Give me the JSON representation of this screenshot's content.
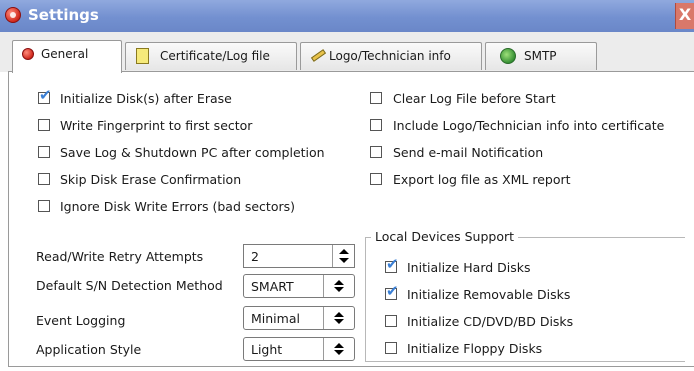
{
  "window": {
    "title": "Settings",
    "close_glyph": "X"
  },
  "tabs": [
    {
      "label": "General",
      "icon": "shield-logo-icon"
    },
    {
      "label": "Certificate/Log file",
      "icon": "document-icon"
    },
    {
      "label": "Logo/Technician info",
      "icon": "pen-icon"
    },
    {
      "label": "SMTP",
      "icon": "email-icon"
    }
  ],
  "options_left": [
    {
      "label": "Initialize Disk(s) after Erase",
      "checked": true
    },
    {
      "label": "Write Fingerprint to first sector",
      "checked": false
    },
    {
      "label": "Save Log & Shutdown PC after completion",
      "checked": false
    },
    {
      "label": "Skip Disk Erase Confirmation",
      "checked": false
    },
    {
      "label": "Ignore Disk Write Errors (bad sectors)",
      "checked": false
    }
  ],
  "options_right": [
    {
      "label": "Clear Log File before Start",
      "checked": false
    },
    {
      "label": "Include Logo/Technician info into certificate",
      "checked": false
    },
    {
      "label": "Send e-mail Notification",
      "checked": false
    },
    {
      "label": "Export log file as XML report",
      "checked": false
    }
  ],
  "fields": {
    "retry": {
      "label": "Read/Write Retry Attempts",
      "value": "2"
    },
    "sn_method": {
      "label": "Default S/N Detection Method",
      "value": "SMART"
    },
    "event_logging": {
      "label": "Event Logging",
      "value": "Minimal"
    },
    "app_style": {
      "label": "Application Style",
      "value": "Light"
    }
  },
  "local_devices": {
    "title": "Local Devices Support",
    "items": [
      {
        "label": "Initialize Hard Disks",
        "checked": true
      },
      {
        "label": "Initialize Removable Disks",
        "checked": true
      },
      {
        "label": "Initialize CD/DVD/BD Disks",
        "checked": false
      },
      {
        "label": "Initialize Floppy Disks",
        "checked": false
      }
    ]
  },
  "colors": {
    "titlebar": "#7a95d3",
    "check": "#3a7fd5"
  }
}
